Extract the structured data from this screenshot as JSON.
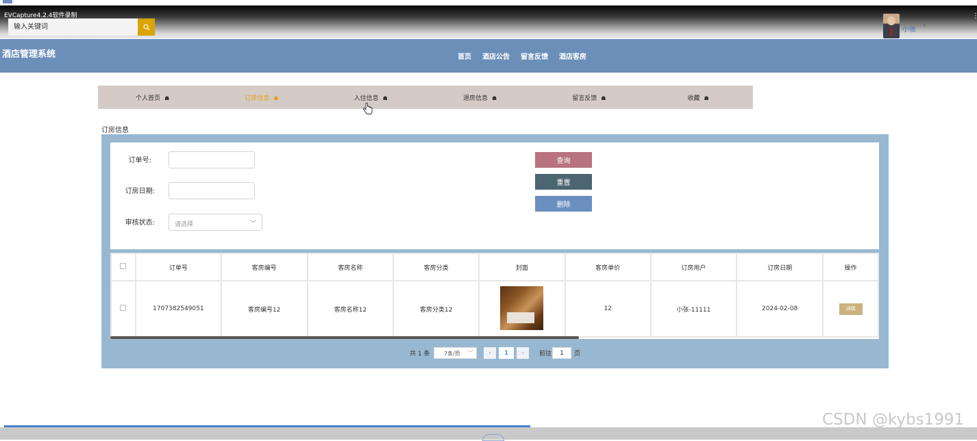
{
  "capture": {
    "title": "EVCapture4.2.4软件录制"
  },
  "topbar": {
    "search_placeholder": "输入关键词",
    "user_name": "小张",
    "user_caret": "▾"
  },
  "header": {
    "logo": "酒店管理系统",
    "nav": [
      "首页",
      "酒店公告",
      "留言反馈",
      "酒店客房"
    ]
  },
  "subnav": {
    "items": [
      {
        "label": "个人首页",
        "active": false
      },
      {
        "label": "订房信息",
        "active": true
      },
      {
        "label": "入住信息",
        "active": false
      },
      {
        "label": "退房信息",
        "active": false
      },
      {
        "label": "留言反馈",
        "active": false
      },
      {
        "label": "收藏",
        "active": false
      }
    ],
    "icon": "☗"
  },
  "section_title": "订房信息",
  "filters": {
    "order_no_label": "订单号:",
    "date_label": "订房日期:",
    "status_label": "审核状态:",
    "status_placeholder": "请选择"
  },
  "actions": {
    "query": "查询",
    "reset": "重置",
    "delete": "删除"
  },
  "table": {
    "headers": [
      "订单号",
      "客房编号",
      "客房名称",
      "客房分类",
      "封面",
      "客房单价",
      "订房用户",
      "订房日期",
      "操作"
    ],
    "rows": [
      {
        "order_no": "1707382549051",
        "room_no": "客房编号12",
        "room_name": "客房名称12",
        "room_category": "客房分类12",
        "price": "12",
        "user": "小张-11111",
        "date": "2024-02-08",
        "action": "详情"
      }
    ]
  },
  "pagination": {
    "total": "共 1 条",
    "page_size": "7条/页",
    "prev": "‹",
    "current": "1",
    "next": "›",
    "goto_label": "前往",
    "goto_value": "1",
    "page_unit": "页"
  },
  "watermark": "CSDN @kybs1991",
  "colors": {
    "header": "#6c8fb9",
    "active_tab": "#e5a217",
    "query_btn": "#b8737e",
    "reset_btn": "#4b6670",
    "delete_btn": "#6b8fbf",
    "detail_btn": "#c9b27e",
    "panel": "#98b8d1"
  }
}
